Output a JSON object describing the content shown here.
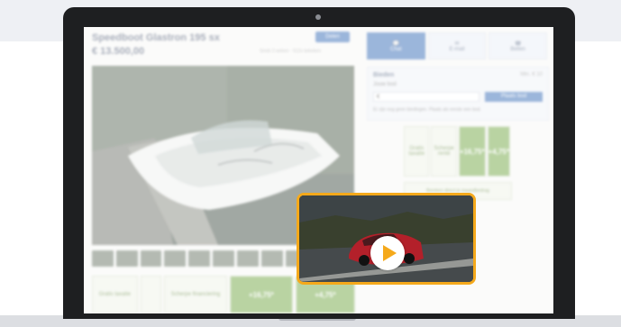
{
  "listing": {
    "title": "Speedboot Glastron 195 sx",
    "price": "€ 13.500,00",
    "share_label": "Delen",
    "meta": "Sinds 3 weken · 512x bekeken"
  },
  "contact": {
    "buttons": [
      {
        "label": "Chat",
        "icon": "chat-icon"
      },
      {
        "label": "E-mail",
        "icon": "mail-icon"
      },
      {
        "label": "Bellen",
        "icon": "phone-icon"
      }
    ]
  },
  "bid": {
    "title": "Bieden",
    "minimum": "Min. € 10",
    "label": "Jouw bod",
    "input_value": "€",
    "button_label": "Plaats bod",
    "note": "Er zijn nog geen biedingen. Plaats als eerste een bod."
  },
  "promo": {
    "left_boxes": [
      "Gratis taxatie",
      "",
      "Scherpe financiering",
      "+16,75*",
      "+4,75*"
    ],
    "right_boxes": [
      "Gratis taxatie",
      "Scherpe rente",
      "+16,75*",
      "+4,75*"
    ],
    "right_note": "Bereken direct je maandbedrag"
  },
  "video": {
    "icon": "play-icon",
    "accent": "#f5a91b"
  },
  "colors": {
    "brand_blue": "#2f66b3",
    "promo_green": "#6da33e",
    "highlight": "#f5a91b",
    "laptop_bezel": "#1e1f21"
  }
}
